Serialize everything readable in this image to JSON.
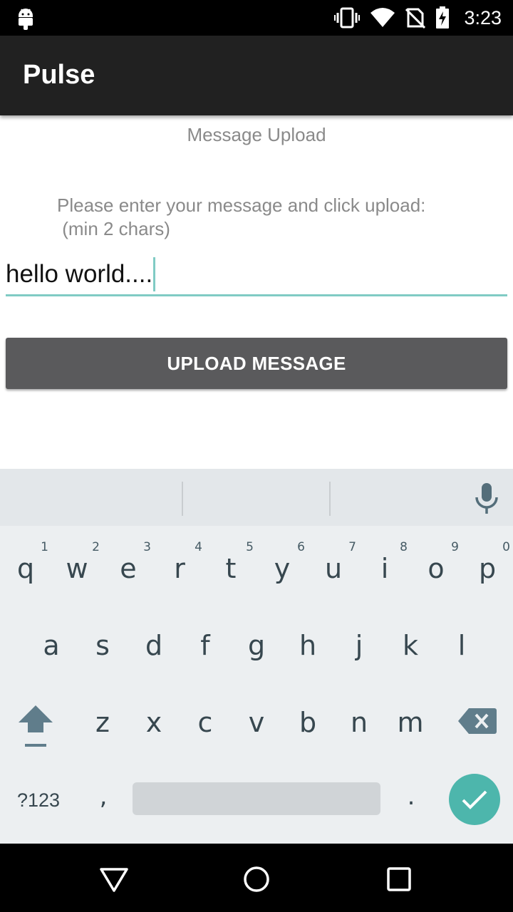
{
  "status_bar": {
    "time": "3:23",
    "icons": [
      "android-icon",
      "vibrate-icon",
      "wifi-icon",
      "no-sim-icon",
      "battery-charging-icon"
    ]
  },
  "app_bar": {
    "title": "Pulse"
  },
  "main": {
    "heading": "Message Upload",
    "prompt": "Please enter your message and click upload:\n (min 2 chars)",
    "message_value": "hello world....",
    "upload_label": "UPLOAD MESSAGE"
  },
  "keyboard": {
    "row1": [
      {
        "letter": "q",
        "hint": "1"
      },
      {
        "letter": "w",
        "hint": "2"
      },
      {
        "letter": "e",
        "hint": "3"
      },
      {
        "letter": "r",
        "hint": "4"
      },
      {
        "letter": "t",
        "hint": "5"
      },
      {
        "letter": "y",
        "hint": "6"
      },
      {
        "letter": "u",
        "hint": "7"
      },
      {
        "letter": "i",
        "hint": "8"
      },
      {
        "letter": "o",
        "hint": "9"
      },
      {
        "letter": "p",
        "hint": "0"
      }
    ],
    "row2": [
      "a",
      "s",
      "d",
      "f",
      "g",
      "h",
      "j",
      "k",
      "l"
    ],
    "row3": [
      "z",
      "x",
      "c",
      "v",
      "b",
      "n",
      "m"
    ],
    "symbols_label": "?123",
    "comma": ",",
    "period": ".",
    "accent_color": "#4db6ac"
  },
  "nav_bar": {
    "icons": [
      "back-icon",
      "home-icon",
      "recents-icon"
    ]
  }
}
